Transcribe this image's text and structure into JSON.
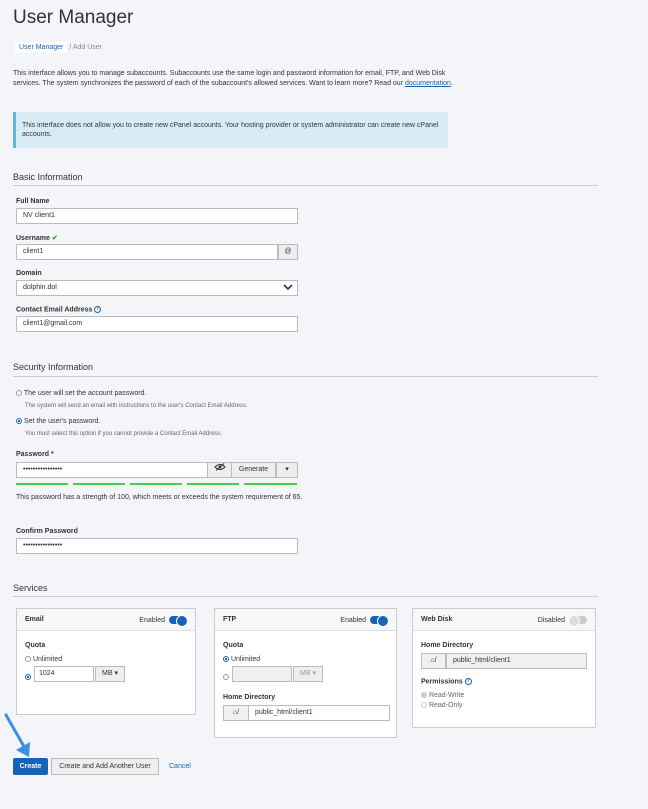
{
  "page": {
    "title": "User Manager"
  },
  "breadcrumb": {
    "parent": "User Manager",
    "current": "/ Add User"
  },
  "intro": {
    "text": "This interface allows you to manage subaccounts. Subaccounts use the same login and password information for email, FTP, and Web Disk services. The system synchronizes the password of each of the subaccount's allowed services. Want to learn more? Read our ",
    "link": "documentation",
    "end": "."
  },
  "notice": "This interface does not allow you to create new cPanel accounts. Your hosting provider or system administrator can create new cPanel accounts.",
  "basic": {
    "heading": "Basic Information",
    "full_name_label": "Full Name",
    "full_name": "NV client1",
    "username_label": "Username",
    "username": "client1",
    "at": "@",
    "domain_label": "Domain",
    "domain": "dolphin.dol",
    "email_label": "Contact Email Address",
    "email": "client1@gmail.com"
  },
  "security": {
    "heading": "Security Information",
    "opt1": "The user will set the account password.",
    "opt1_sub": "The system will send an email with instructions to the user's Contact Email Address.",
    "opt2": "Set the user's password.",
    "opt2_sub": "You must select this option if you cannot provide a Contact Email Address.",
    "password_label": "Password",
    "required": "*",
    "password": "••••••••••••••••",
    "generate": "Generate",
    "strength": "This password has a strength of 100, which meets or exceeds the system requirement of 65.",
    "confirm_label": "Confirm Password",
    "confirm": "••••••••••••••••"
  },
  "services": {
    "heading": "Services",
    "email": {
      "title": "Email",
      "status": "Enabled",
      "quota_label": "Quota",
      "unlimited": "Unlimited",
      "quota": "1024",
      "unit": "MB"
    },
    "ftp": {
      "title": "FTP",
      "status": "Enabled",
      "quota_label": "Quota",
      "unlimited": "Unlimited",
      "unit": "MB",
      "home_label": "Home Directory",
      "home_prefix": "/",
      "home": "public_html/client1"
    },
    "webdisk": {
      "title": "Web Disk",
      "status": "Disabled",
      "home_label": "Home Directory",
      "home_prefix": "/",
      "home": "public_html/client1",
      "perm_label": "Permissions",
      "rw": "Read-Write",
      "ro": "Read-Only"
    }
  },
  "actions": {
    "create": "Create",
    "another": "Create and Add Another User",
    "cancel": "Cancel"
  }
}
